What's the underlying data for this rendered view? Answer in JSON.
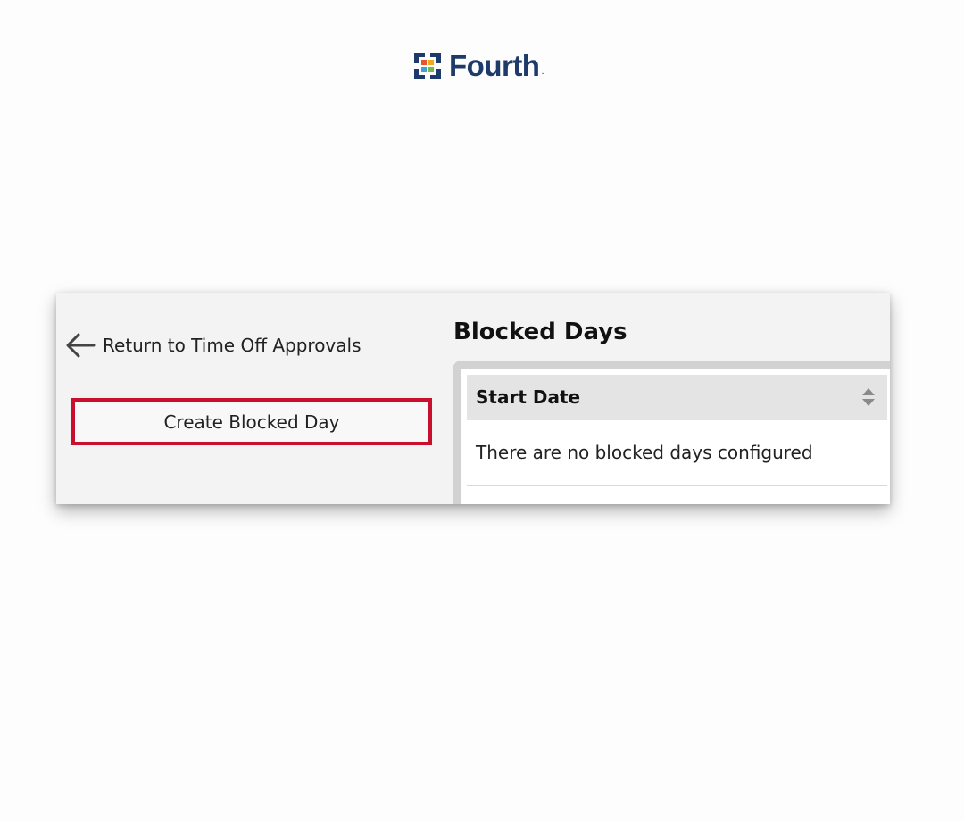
{
  "logo": {
    "text": "Fourth",
    "trademark": "."
  },
  "back_link": {
    "label": "Return to Time Off Approvals",
    "icon": "arrow-left-icon"
  },
  "create_button": {
    "label": "Create Blocked Day",
    "highlight_color": "#c8102e"
  },
  "section": {
    "title": "Blocked Days"
  },
  "table": {
    "columns": [
      {
        "label": "Start Date",
        "sort_icon": "sort-icon"
      }
    ],
    "empty_message": "There are no blocked days configured"
  },
  "colors": {
    "brand": "#1d3a6b",
    "highlight": "#c8102e",
    "panel_bg": "#f3f3f3",
    "header_bg": "#e4e4e4"
  }
}
